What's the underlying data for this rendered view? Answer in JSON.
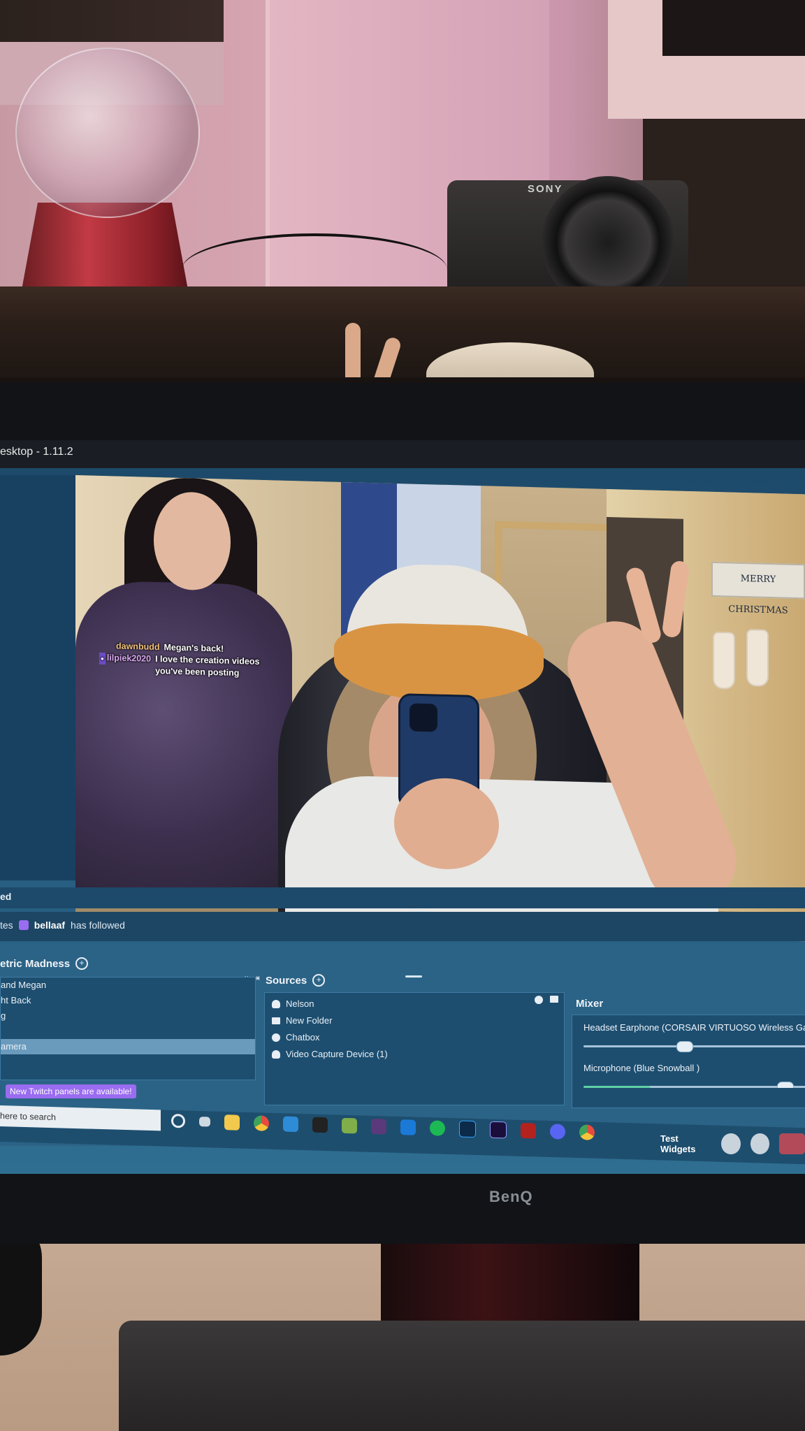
{
  "window": {
    "title": "esktop - 1.11.2"
  },
  "preview": {
    "sign_text": "MERRY CHRISTMAS",
    "camera_brand": "SONY",
    "chat": [
      {
        "user": "dawnbudd",
        "message": "Megan's back!"
      },
      {
        "user": "lilpiek2020",
        "message": "I love the creation videos you've been posting"
      }
    ]
  },
  "scene_header": "ed",
  "event": {
    "prefix": "tes",
    "user": "bellaaf",
    "action": "has followed"
  },
  "scenes": {
    "title": "etric Madness",
    "items": [
      "and Megan",
      "ht Back",
      "g",
      "",
      "amera"
    ],
    "selected_index": 4
  },
  "sources": {
    "title": "Sources",
    "items": [
      {
        "icon": "user-icon",
        "label": "Nelson"
      },
      {
        "icon": "folder-icon",
        "label": "New Folder"
      },
      {
        "icon": "chat-icon",
        "label": "Chatbox"
      },
      {
        "icon": "user-icon",
        "label": "Video Capture Device (1)"
      }
    ]
  },
  "mixer": {
    "title": "Mixer",
    "tracks": [
      {
        "name": "Headset Earphone (CORSAIR VIRTUOSO Wireless Gar",
        "level": 0.48
      },
      {
        "name": "Microphone (Blue Snowball )",
        "level": 0.96
      }
    ]
  },
  "notice": "New Twitch panels are available!",
  "taskbar": {
    "search_placeholder": "here to search",
    "test_widgets": "Test Widgets",
    "icons": [
      "cortana-icon",
      "task-view-icon",
      "file-explorer-icon",
      "chrome-icon",
      "store-icon",
      "epic-games-icon",
      "minecraft-icon",
      "vegas-icon",
      "outlook-icon",
      "spotify-icon",
      "photoshop-icon",
      "premiere-icon",
      "illustrator-icon",
      "discord-icon",
      "chrome-icon-2"
    ]
  },
  "monitor_brand": "BenQ",
  "colors": {
    "accent": "#9a6cf0",
    "dock_bg": "#2b6386",
    "panel_bg": "#1d4e70"
  }
}
